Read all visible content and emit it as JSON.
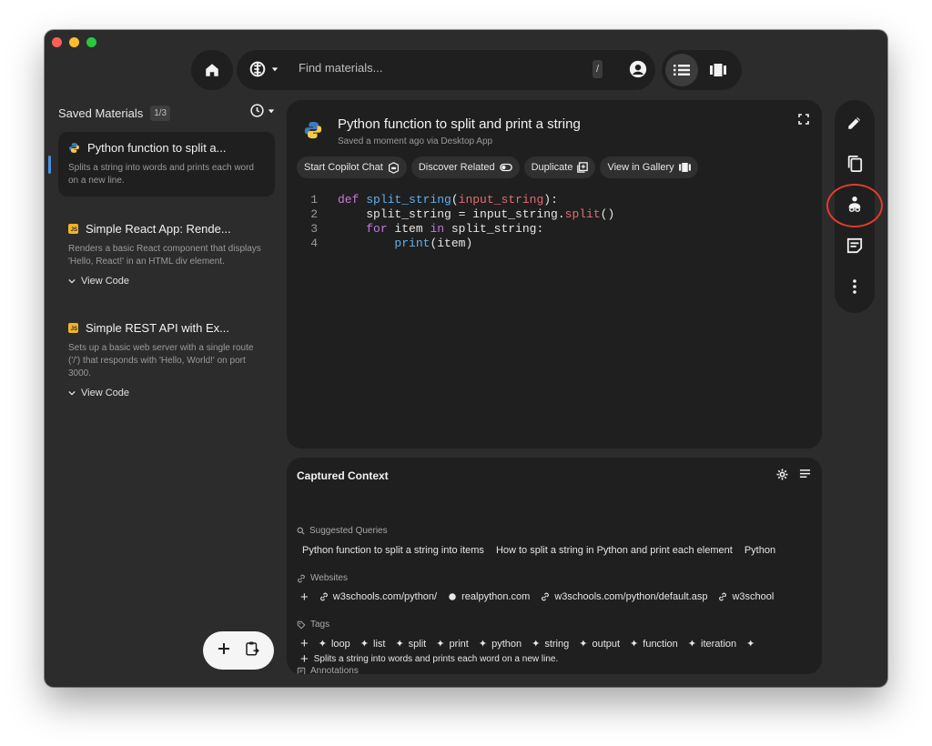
{
  "topbar": {
    "search_placeholder": "Find materials...",
    "slash_hint": "/"
  },
  "saved": {
    "title": "Saved Materials",
    "count": "1/3",
    "items": [
      {
        "title": "Python function to split a...",
        "description": "Splits a string into words and prints each word on a new line.",
        "icon": "python-icon",
        "selected": true
      },
      {
        "title": "Simple React App: Rende...",
        "description": "Renders a basic React component that displays 'Hello, React!' in an HTML div element.",
        "icon": "javascript-icon",
        "view_code": "View Code"
      },
      {
        "title": "Simple REST API with Ex...",
        "description": "Sets up a basic web server with a single route ('/') that responds with 'Hello, World!' on port 3000.",
        "icon": "javascript-icon",
        "view_code": "View Code"
      }
    ]
  },
  "detail": {
    "title": "Python function to split and print a string",
    "subtitle": "Saved a moment ago via Desktop App",
    "actions": [
      "Start Copilot Chat",
      "Discover Related",
      "Duplicate",
      "View in Gallery"
    ],
    "code_lines": [
      {
        "n": "1",
        "text": "def split_string(input_string):"
      },
      {
        "n": "2",
        "text": "    split_string = input_string.split()"
      },
      {
        "n": "3",
        "text": "    for item in split_string:"
      },
      {
        "n": "4",
        "text": "        print(item)"
      }
    ]
  },
  "context": {
    "title": "Captured Context",
    "suggested_label": "Suggested Queries",
    "suggested": [
      "Python function to split a string into items",
      "How to split a string in Python and print each element",
      "Python"
    ],
    "websites_label": "Websites",
    "websites": [
      "w3schools.com/python/",
      "realpython.com",
      "w3schools.com/python/default.asp",
      "w3school"
    ],
    "tags_label": "Tags",
    "tags": [
      "loop",
      "list",
      "split",
      "print",
      "python",
      "string",
      "output",
      "function",
      "iteration"
    ],
    "annotations_label": "Annotations",
    "annotation": "Splits a string into words and prints each word on a new line."
  },
  "colors": {
    "accent": "#4a90e2",
    "highlight_ring": "#e33b2e",
    "keyword": "#c678dd",
    "function": "#61afef",
    "param": "#e06c75"
  }
}
